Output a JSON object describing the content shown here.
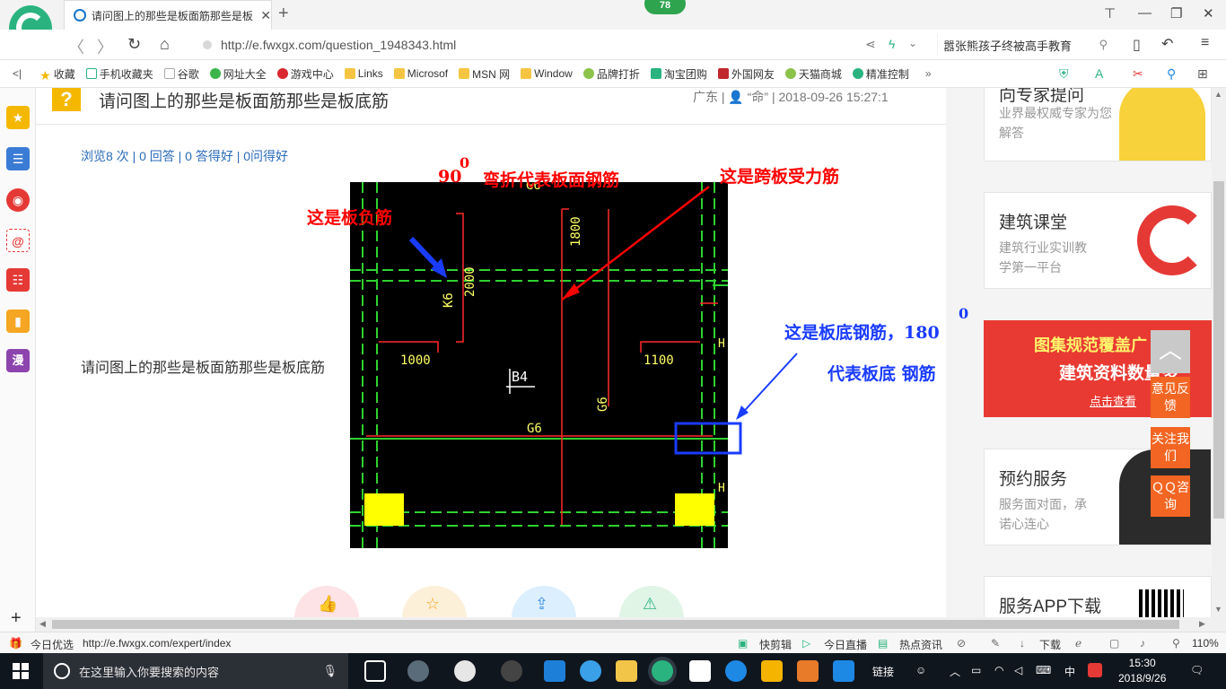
{
  "browser": {
    "badge_count": "78",
    "tab_title": "请问图上的那些是板面筋那些是板",
    "url": "http://e.fwxgx.com/question_1948343.html",
    "search_text": "嚣张熊孩子终被高手教育"
  },
  "bookmarks": [
    "收藏",
    "手机收藏夹",
    "谷歌",
    "网址大全",
    "游戏中心",
    "Links",
    "Microsof",
    "MSN 网",
    "Window",
    "品牌打折",
    "淘宝团购",
    "外国网友",
    "天猫商城",
    "精准控制"
  ],
  "question": {
    "title": "请问图上的那些是板面筋那些是板底筋",
    "meta": "广东 | 👤 “命” | 2018-09-26 15:27:1",
    "stats": "浏览8 次 | 0 回答 | 0 答得好 | 0问得好",
    "body": "请问图上的那些是板面筋那些是板底筋"
  },
  "drawing": {
    "annotations": {
      "bend_num": "90",
      "bend_sup": "0",
      "bend_text": "弯折代表板面钢筋",
      "span_text": "这是跨板受力筋",
      "neg_text": "这是板负筋",
      "bottom_text": "这是板底钢筋，180",
      "bottom_sup": "0",
      "bottom_text2": "代表板底 钢筋"
    },
    "cad_labels": {
      "g6_top": "G6",
      "dim_1800": "1800",
      "dim_2000": "2000",
      "k6": "K6",
      "dim_1000": "1000",
      "b4": "B4",
      "dim_1100": "1100",
      "g6_v": "G6",
      "g6_bottom": "G6",
      "h1": "H",
      "h2": "H"
    }
  },
  "sidebar": {
    "card1_title": "向专家提问",
    "card1_desc": "业界最权威专家为您解答",
    "card2_title": "建筑课堂",
    "card2_desc1": "建筑行业实训教",
    "card2_desc2": "学第一平台",
    "banner_line1": "图集规范覆盖广",
    "banner_line2": "建筑资料数量多",
    "banner_link": "点击查看",
    "card4_title": "预约服务",
    "card4_desc1": "服务面对面，承",
    "card4_desc2": "诺心连心",
    "card5_title": "服务APP下载",
    "float1": "意见反馈",
    "float2": "关注我们",
    "float3": "ＱＱ咨询"
  },
  "statusbar": {
    "left": "今日优选",
    "link": "http://e.fwxgx.com/expert/index",
    "kuaijianji": "快剪辑",
    "zhibo": "今日直播",
    "redian": "热点资讯",
    "download": "下载",
    "zoom": "110%"
  },
  "taskbar": {
    "search_placeholder": "在这里输入你要搜索的内容",
    "links": "链接",
    "ime": "中",
    "time": "15:30",
    "date": "2018/9/26"
  },
  "colors": {
    "accent_green": "#2ab37f",
    "orange": "#f26522",
    "link_blue": "#2a6bb8",
    "annotation_red": "#ff0000",
    "annotation_blue": "#0000ff"
  }
}
